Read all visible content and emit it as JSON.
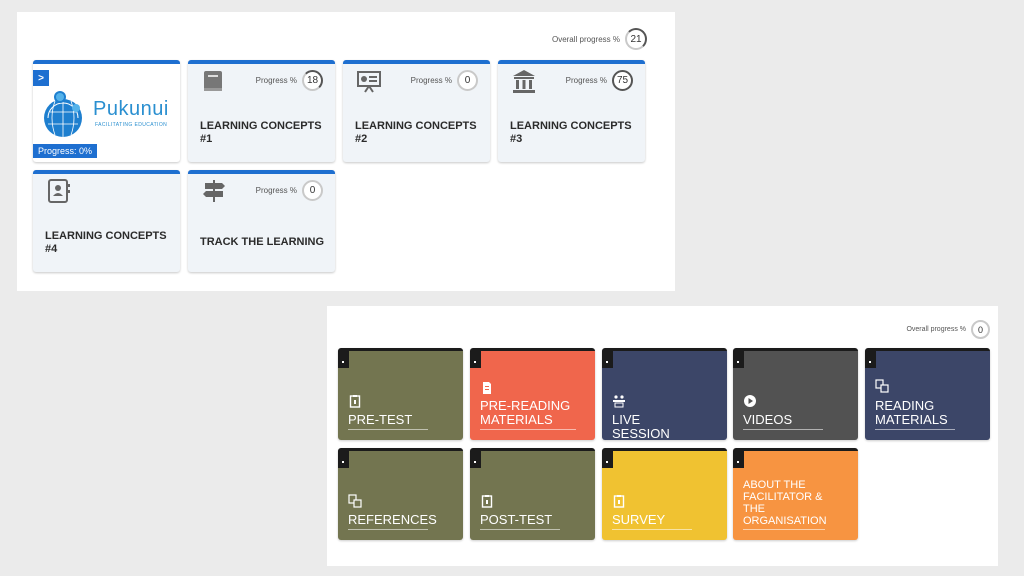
{
  "panel1": {
    "overall": {
      "label": "Overall progress %",
      "value": "21"
    },
    "logo": {
      "arrow": ">",
      "brand": "Pukunui",
      "tagline": "FACILITATING EDUCATION",
      "progress": "Progress: 0%"
    },
    "cards": [
      {
        "title": "LEARNING CONCEPTS #1",
        "progress_label": "Progress %",
        "progress": "18",
        "icon": "book-icon"
      },
      {
        "title": "LEARNING CONCEPTS #2",
        "progress_label": "Progress %",
        "progress": "0",
        "icon": "presentation-icon"
      },
      {
        "title": "LEARNING CONCEPTS #3",
        "progress_label": "Progress %",
        "progress": "75",
        "icon": "building-icon"
      },
      {
        "title": "LEARNING CONCEPTS #4",
        "progress_label": "",
        "progress": "",
        "icon": "contact-book-icon"
      },
      {
        "title": "TRACK THE LEARNING",
        "progress_label": "Progress %",
        "progress": "0",
        "icon": "signpost-icon"
      }
    ]
  },
  "panel2": {
    "overall": {
      "label": "Overall progress %",
      "value": "0"
    },
    "tiles": [
      {
        "label": "PRE-TEST",
        "color": "#737550",
        "icon": "clipboard-icon"
      },
      {
        "label": "PRE-READING MATERIALS",
        "color": "#f0664c",
        "icon": "document-icon"
      },
      {
        "label": "LIVE SESSION",
        "color": "#3c4668",
        "icon": "session-icon"
      },
      {
        "label": "VIDEOS",
        "color": "#525252",
        "icon": "play-icon"
      },
      {
        "label": "READING MATERIALS",
        "color": "#3c4668",
        "icon": "pages-icon"
      },
      {
        "label": "REFERENCES",
        "color": "#737550",
        "icon": "pages-icon"
      },
      {
        "label": "POST-TEST",
        "color": "#737550",
        "icon": "clipboard-icon"
      },
      {
        "label": "SURVEY",
        "color": "#f0c231",
        "icon": "clipboard-icon"
      },
      {
        "label": "ABOUT THE FACILITATOR & THE ORGANISATION",
        "color": "#f79441",
        "icon": ""
      }
    ]
  }
}
